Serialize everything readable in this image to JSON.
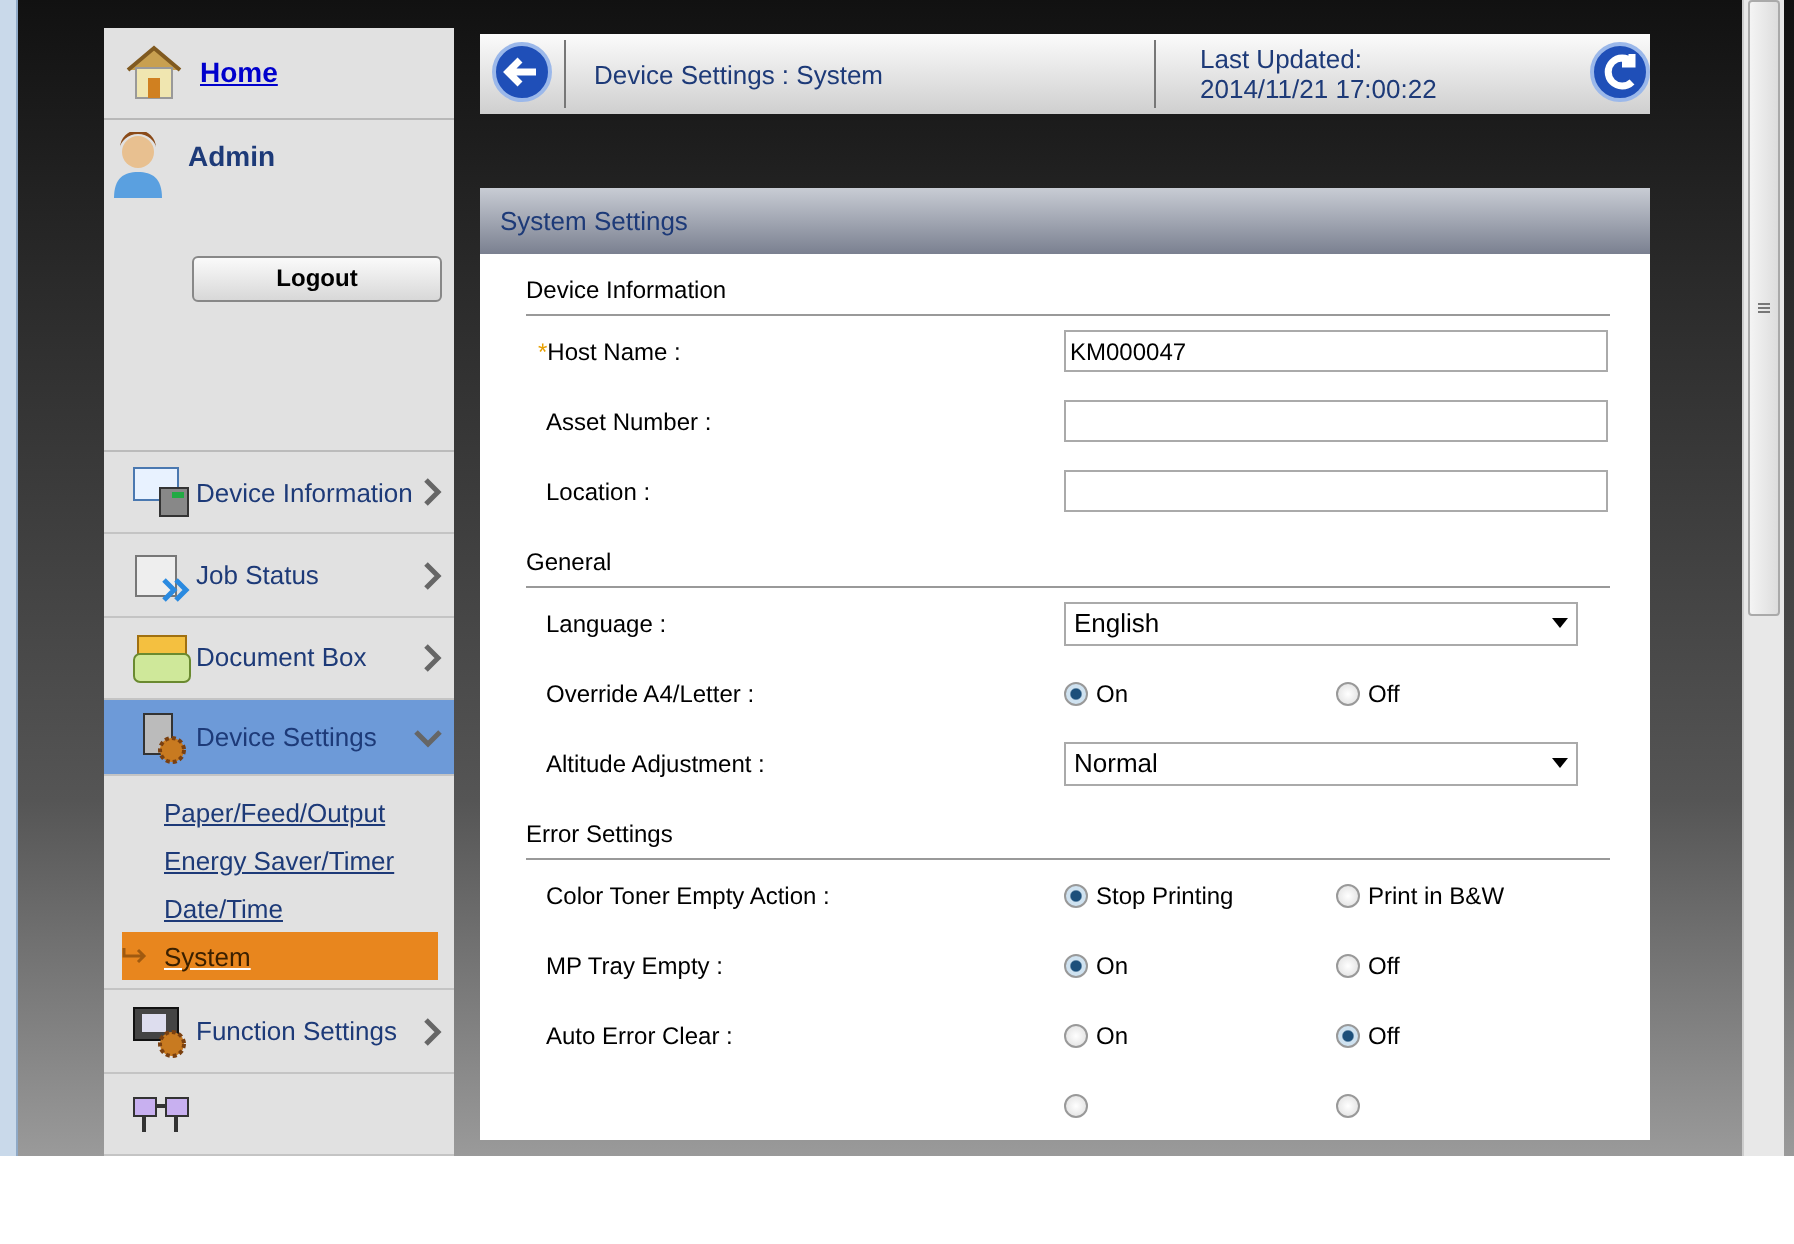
{
  "sidebar": {
    "home": "Home",
    "user": "Admin",
    "logout": "Logout",
    "items": [
      {
        "label": "Device Information",
        "kind": "device",
        "expanded": false,
        "selected": false
      },
      {
        "label": "Job Status",
        "kind": "jobs",
        "expanded": false,
        "selected": false
      },
      {
        "label": "Document Box",
        "kind": "box",
        "expanded": false,
        "selected": false
      },
      {
        "label": "Device Settings",
        "kind": "settings",
        "expanded": true,
        "selected": true,
        "children": [
          {
            "label": "Paper/Feed/Output",
            "selected": false
          },
          {
            "label": "Energy Saver/Timer",
            "selected": false
          },
          {
            "label": "Date/Time",
            "selected": false
          },
          {
            "label": "System",
            "selected": true
          }
        ]
      },
      {
        "label": "Function Settings",
        "kind": "function",
        "expanded": false,
        "selected": false
      }
    ]
  },
  "header": {
    "breadcrumb": "Device Settings : System",
    "last_updated_label": "Last Updated:",
    "last_updated": "2014/11/21 17:00:22"
  },
  "panel": {
    "title": "System Settings",
    "sections": [
      {
        "title": "Device Information",
        "rows": [
          {
            "kind": "text",
            "marker": "*",
            "label": "Host Name :",
            "value": "KM000047"
          },
          {
            "kind": "text",
            "label": "Asset Number :"
          },
          {
            "kind": "text",
            "label": "Location :"
          }
        ]
      },
      {
        "title": "General",
        "rows": [
          {
            "kind": "select",
            "label": "Language :",
            "value": "English"
          },
          {
            "kind": "radio",
            "label": "Override A4/Letter :",
            "options": [
              {
                "label": "On",
                "selected": true
              },
              {
                "label": "Off",
                "selected": false
              }
            ]
          },
          {
            "kind": "select",
            "label": "Altitude Adjustment :",
            "value": "Normal"
          }
        ]
      },
      {
        "title": "Error Settings",
        "rows": [
          {
            "kind": "radio",
            "label": "Color Toner Empty Action :",
            "options": [
              {
                "label": "Stop Printing",
                "selected": true
              },
              {
                "label": "Print in B&W",
                "selected": false
              }
            ]
          },
          {
            "kind": "radio",
            "label": "MP Tray Empty :",
            "options": [
              {
                "label": "On",
                "selected": true
              },
              {
                "label": "Off",
                "selected": false
              }
            ]
          },
          {
            "kind": "radio",
            "label": "Auto Error Clear :",
            "options": [
              {
                "label": "On",
                "selected": false
              },
              {
                "label": "Off",
                "selected": true
              }
            ]
          },
          {
            "kind": "radio",
            "options": [
              {
                "selected": false
              },
              {
                "selected": false
              }
            ]
          }
        ]
      }
    ]
  }
}
